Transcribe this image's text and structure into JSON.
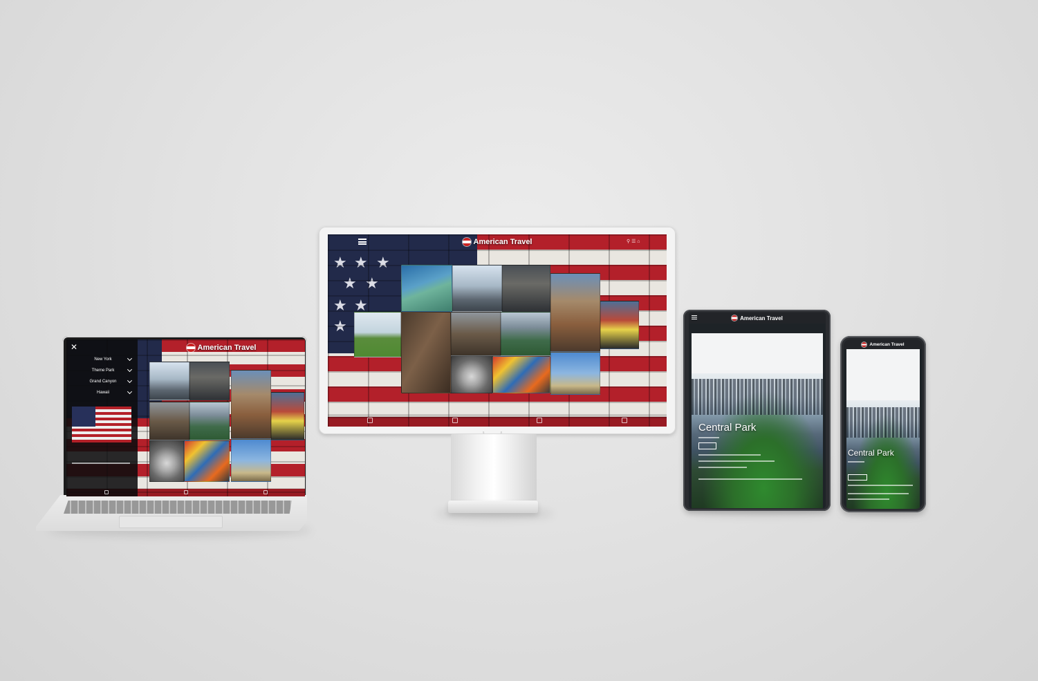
{
  "site": {
    "brand": "American Travel"
  },
  "laptop": {
    "menu": {
      "close_icon": "close-icon",
      "items": [
        {
          "label": "New York"
        },
        {
          "label": "Theme Park"
        },
        {
          "label": "Grand Canyon"
        },
        {
          "label": "Hawaii"
        }
      ]
    }
  },
  "tablet": {
    "hero_title": "Central Park"
  },
  "phone": {
    "hero_title": "Central Park"
  },
  "colors": {
    "flag_red": "#b3202a",
    "flag_blue": "#222a4a",
    "flag_white": "#e9e6e0",
    "park_green": "#2f8a2e"
  }
}
